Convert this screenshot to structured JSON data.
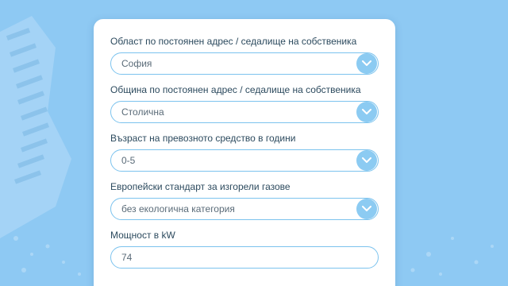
{
  "form": {
    "fields": [
      {
        "label": "Област по постоянен адрес / седалище на собственика",
        "value": "София",
        "type": "select"
      },
      {
        "label": "Община по постоянен адрес / седалище на собственика",
        "value": "Столична",
        "type": "select"
      },
      {
        "label": "Възраст на превозното средство в години",
        "value": "0-5",
        "type": "select"
      },
      {
        "label": "Европейски стандарт за изгорели газове",
        "value": "без екологична категория",
        "type": "select"
      },
      {
        "label": "Мощност в kW",
        "value": "74",
        "type": "input"
      }
    ]
  },
  "colors": {
    "background": "#8ec9f3",
    "card": "#ffffff",
    "field_border": "#7cc3ee",
    "chevron_button": "#8ccbf2",
    "label_text": "#2c4a5e"
  },
  "icons": {
    "select_chevron": "chevron-down-icon"
  }
}
